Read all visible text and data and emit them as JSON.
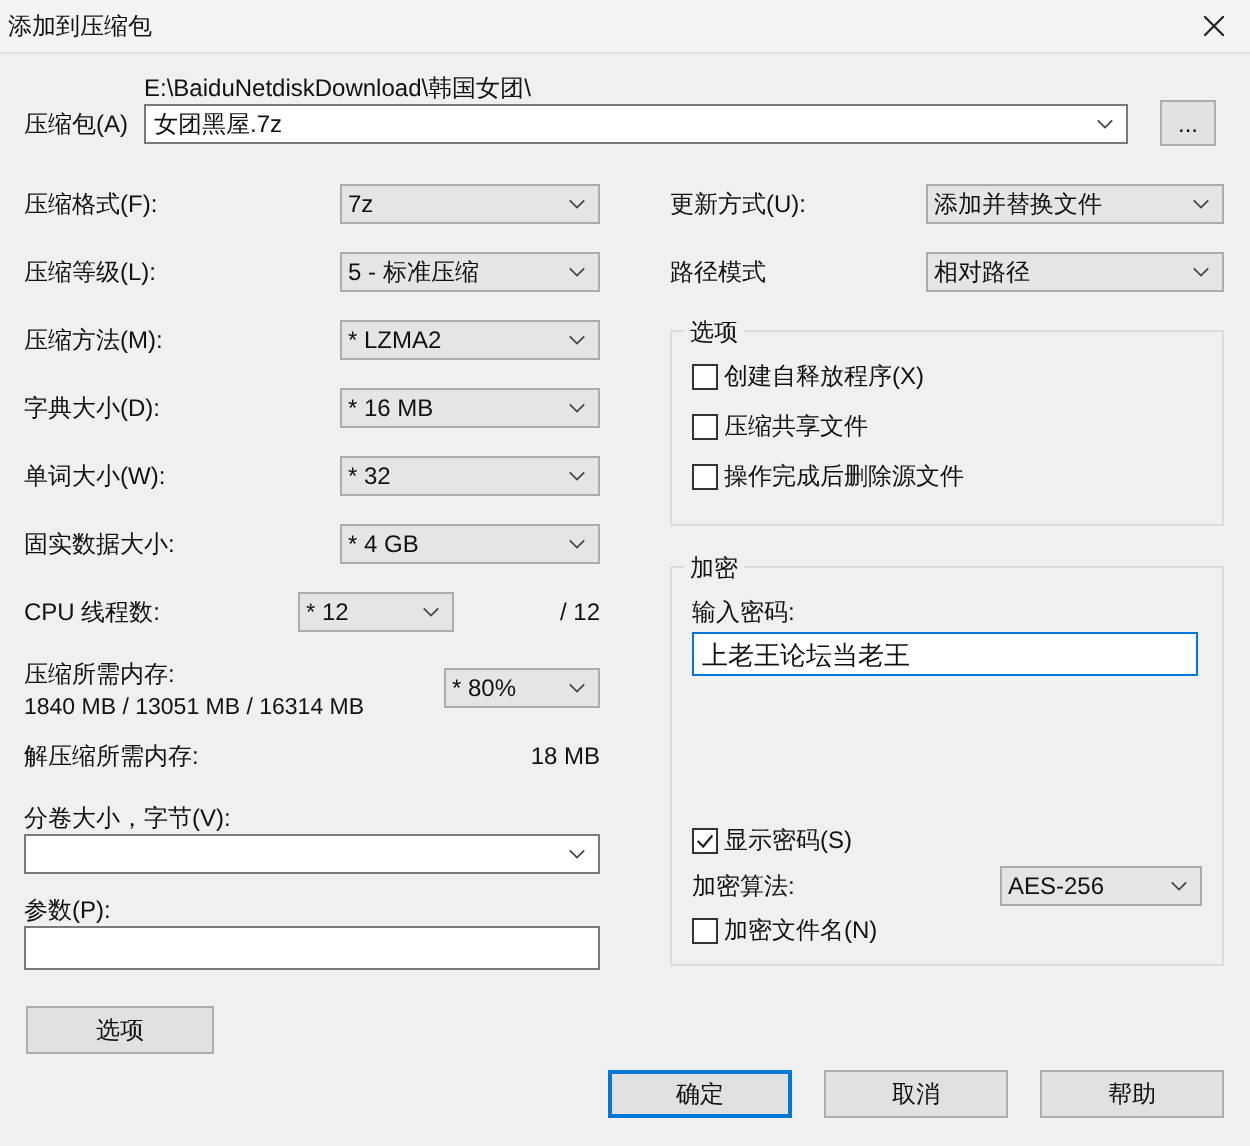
{
  "window": {
    "title": "添加到压缩包"
  },
  "archive": {
    "label": "压缩包(A)",
    "path": "E:\\BaiduNetdiskDownload\\韩国女团\\",
    "value": "女团黑屋.7z",
    "browse": "..."
  },
  "settings": [
    {
      "kind": "select",
      "label": "压缩格式(F):",
      "value": "7z"
    },
    {
      "kind": "select",
      "label": "压缩等级(L):",
      "value": "5 - 标准压缩"
    },
    {
      "kind": "select",
      "label": "压缩方法(M):",
      "value": "* LZMA2"
    },
    {
      "kind": "select",
      "label": "字典大小(D):",
      "value": "* 16 MB"
    },
    {
      "kind": "select",
      "label": "单词大小(W):",
      "value": "* 32"
    },
    {
      "kind": "select",
      "label": "固实数据大小:",
      "value": "* 4 GB"
    },
    {
      "kind": "threads",
      "label": "CPU 线程数:",
      "value": "* 12",
      "reading": "/ 12"
    },
    {
      "kind": "memory",
      "label": "压缩所需内存:",
      "reading": "1840 MB / 13051 MB / 16314 MB",
      "value": "* 80%"
    },
    {
      "kind": "info",
      "label": "解压缩所需内存:",
      "reading": "18 MB"
    }
  ],
  "volume": {
    "label": "分卷大小，字节(V):"
  },
  "parameters": {
    "label": "参数(P):"
  },
  "options_button": "选项",
  "update_mode": {
    "label": "更新方式(U):",
    "value": "添加并替换文件"
  },
  "path_mode": {
    "label": "路径模式",
    "value": "相对路径"
  },
  "options": {
    "title": "选项",
    "items": [
      {
        "label": "创建自释放程序(X)",
        "checked": false
      },
      {
        "label": "压缩共享文件",
        "checked": false
      },
      {
        "label": "操作完成后删除源文件",
        "checked": false
      }
    ]
  },
  "encryption": {
    "title": "加密",
    "password_label": "输入密码:",
    "password": "上老王论坛当老王",
    "show_password": {
      "label": "显示密码(S)",
      "checked": true
    },
    "method_label": "加密算法:",
    "method": "AES-256",
    "encrypt_names": {
      "label": "加密文件名(N)",
      "checked": false
    }
  },
  "buttons": [
    {
      "label": "确定",
      "default": true
    },
    {
      "label": "取消",
      "default": false
    },
    {
      "label": "帮助",
      "default": false
    }
  ]
}
